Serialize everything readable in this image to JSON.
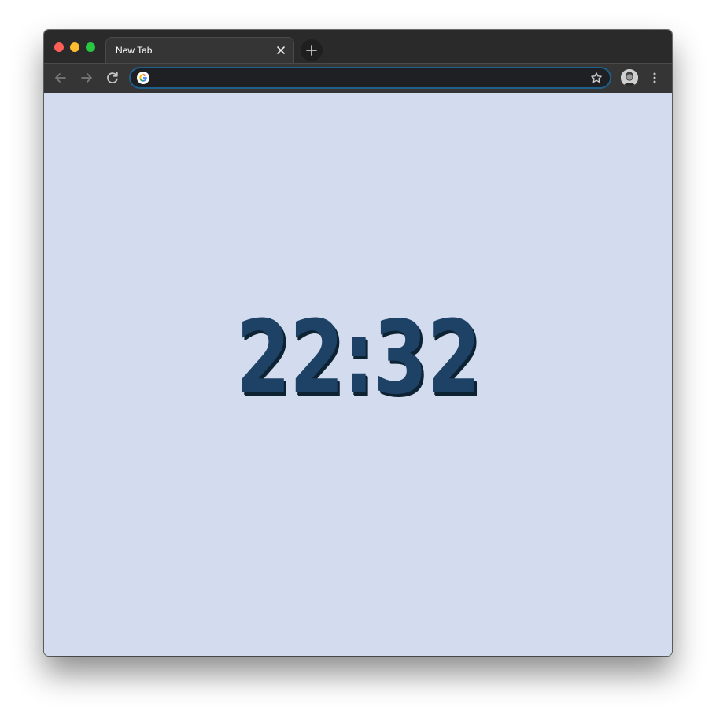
{
  "window": {
    "traffic_lights": [
      "close",
      "minimize",
      "zoom"
    ]
  },
  "tabs": [
    {
      "title": "New Tab",
      "active": true
    }
  ],
  "toolbar": {
    "back_icon": "arrow-left-icon",
    "forward_icon": "arrow-right-icon",
    "reload_icon": "reload-icon",
    "omnibox": {
      "value": "",
      "placeholder": ""
    },
    "bookmark_icon": "star-icon",
    "menu_icon": "kebab-menu-icon"
  },
  "content": {
    "clock_time": "22:32",
    "background_color": "#d3dcee",
    "clock_color": "#1e4266"
  }
}
